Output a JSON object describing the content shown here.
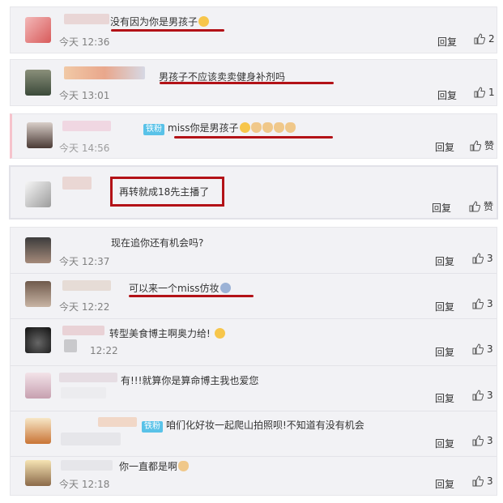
{
  "ui": {
    "reply_label": "回复",
    "like_label": "赞"
  },
  "comments": [
    {
      "text": "没有因为你是男孩子",
      "time": "今天 12:36",
      "likes": "2"
    },
    {
      "text": "男孩子不应该卖卖健身补剂吗",
      "time": "今天 13:01",
      "likes": "1"
    },
    {
      "badge": "铁粉",
      "text": "miss你是男孩子",
      "time": "今天 14:56",
      "likes": "赞"
    },
    {
      "text": "再转就成18先主播了",
      "likes": "赞"
    },
    {
      "text": "现在追你还有机会吗?",
      "time": "今天 12:37",
      "likes": "3"
    },
    {
      "text": "可以来一个miss仿妆",
      "time": "今天 12:22",
      "likes": "3"
    },
    {
      "text": "转型美食博主啊奥力给!",
      "time": "12:22",
      "likes": "3"
    },
    {
      "text": "有!!!就算你是算命博主我也爱您",
      "likes": "3"
    },
    {
      "badge": "铁粉",
      "text": "咱们化好妆一起爬山拍照呗!不知道有没有机会",
      "likes": "3"
    },
    {
      "text": "你一直都是啊",
      "time": "今天 12:18",
      "likes": "3"
    }
  ],
  "colors": {
    "highlight": "#b31217",
    "card_bg": "#f2f2f5",
    "muted": "#808080"
  },
  "icons": [
    "thumbs-up-icon",
    "emoji-icon",
    "cat-emoji-icon"
  ]
}
